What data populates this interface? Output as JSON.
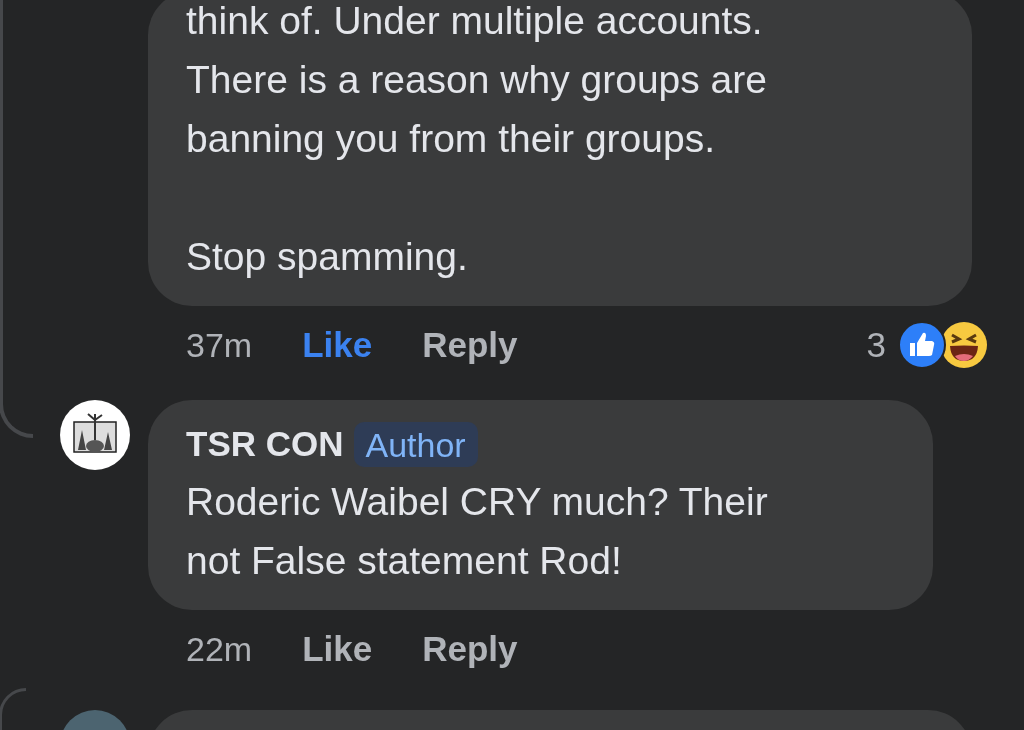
{
  "comments": [
    {
      "paragraphs": [
        "think of. Under multiple accounts. There is a reason why groups are banning you from their groups.",
        "Stop spamming."
      ],
      "time": "37m",
      "like": {
        "label": "Like",
        "selected": true
      },
      "reply": "Reply",
      "reactions": {
        "count": "3",
        "icons": [
          {
            "kind": "like"
          },
          {
            "kind": "haha"
          }
        ]
      }
    },
    {
      "author": "TSR CON",
      "badge": "Author",
      "avatar": {
        "kind": "drawing"
      },
      "paragraphs": [
        "Roderic Waibel CRY much? Their not False statement Rod!"
      ],
      "time": "22m",
      "like": {
        "label": "Like",
        "selected": false
      },
      "reply": "Reply"
    },
    {
      "avatar": {
        "kind": "photo"
      }
    }
  ]
}
